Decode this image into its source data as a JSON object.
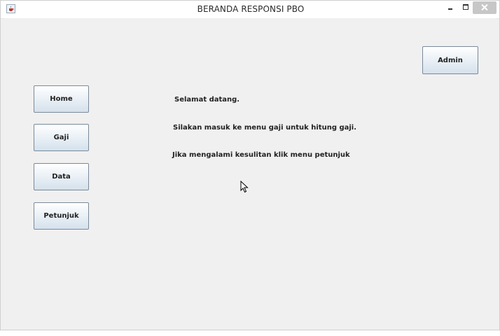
{
  "window": {
    "title": "BERANDA RESPONSI PBO",
    "icon": "java-cup-icon",
    "controls": [
      "minimize-icon",
      "maximize-icon",
      "close-icon"
    ]
  },
  "toolbar": {
    "admin_label": "Admin"
  },
  "menu": {
    "items": [
      {
        "label": "Home"
      },
      {
        "label": "Gaji"
      },
      {
        "label": "Data"
      },
      {
        "label": "Petunjuk"
      }
    ]
  },
  "main": {
    "messages": [
      "Selamat datang.",
      "Silakan masuk ke menu gaji untuk hitung gaji.",
      "Jika mengalami kesulitan klik menu petunjuk"
    ]
  },
  "colors": {
    "window_bg": "#f0f0f0",
    "button_border": "#7a8a99",
    "close_bg": "#c7c7c7"
  }
}
